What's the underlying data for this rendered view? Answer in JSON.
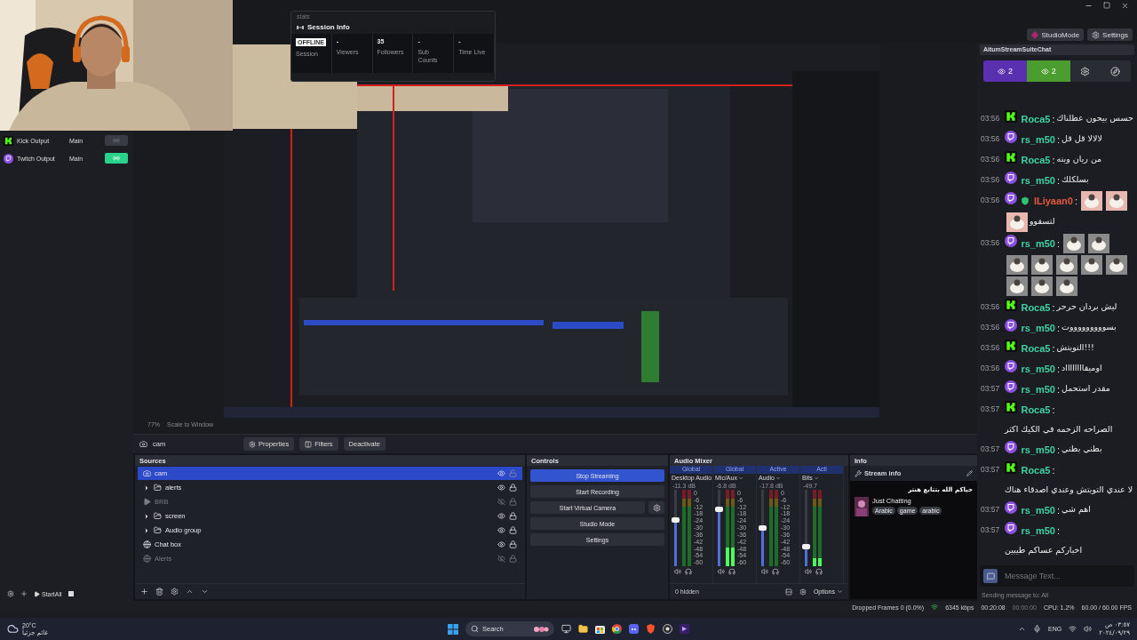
{
  "top_bar": {
    "buttons": [
      {
        "label": "StudioMode",
        "kind": "studio"
      },
      {
        "label": "Settings",
        "kind": "settings"
      }
    ]
  },
  "session_info": {
    "header": "stats",
    "title": "Session Info",
    "stats": [
      {
        "value": "OFFLINE",
        "label": "Session",
        "kind": "badge"
      },
      {
        "value": "-",
        "label": "Viewers",
        "kind": "plain"
      },
      {
        "value": "35",
        "label": "Followers",
        "kind": "plain"
      },
      {
        "value": "-",
        "label": "Sub Counts",
        "kind": "plain"
      },
      {
        "value": "-",
        "label": "Time Live",
        "kind": "plain"
      }
    ]
  },
  "outputs": {
    "items": [
      {
        "kind": "kick",
        "name": "Kick Output",
        "scene": "Main",
        "on": false
      },
      {
        "kind": "twitch",
        "name": "Twitch Output",
        "scene": "Main",
        "on": true
      }
    ],
    "start_label": "StartAll"
  },
  "preview": {
    "zoom": "77%",
    "scale_mode": "Scale to Window"
  },
  "toolbar": {
    "source": "cam",
    "buttons": [
      {
        "label": "Properties",
        "kind": "properties"
      },
      {
        "label": "Filters",
        "kind": "filters"
      },
      {
        "label": "Deactivate",
        "kind": "plain"
      }
    ]
  },
  "sources": {
    "title": "Sources",
    "items": [
      {
        "name": "cam",
        "kind": "camera",
        "selected": true,
        "visible": true,
        "locked": false
      },
      {
        "name": "alerts",
        "kind": "group",
        "selected": false,
        "visible": true,
        "locked": true
      },
      {
        "name": "BRB",
        "kind": "media",
        "selected": false,
        "visible": false,
        "locked": true
      },
      {
        "name": "screen",
        "kind": "group",
        "selected": false,
        "visible": true,
        "locked": true
      },
      {
        "name": "Audio group",
        "kind": "group",
        "selected": false,
        "visible": true,
        "locked": true
      },
      {
        "name": "Chat box",
        "kind": "browser",
        "selected": false,
        "visible": true,
        "locked": true
      },
      {
        "name": "Alerts",
        "kind": "browser",
        "selected": false,
        "visible": false,
        "locked": true
      }
    ]
  },
  "controls": {
    "title": "Controls",
    "buttons": [
      {
        "label": "Stop Streaming",
        "active": true,
        "kind": "plain"
      },
      {
        "label": "Start Recording",
        "active": false,
        "kind": "plain"
      },
      {
        "label": "Start Virtual Camera",
        "active": false,
        "kind": "with_gear"
      },
      {
        "label": "Studio Mode",
        "active": false,
        "kind": "plain"
      },
      {
        "label": "Settings",
        "active": false,
        "kind": "plain"
      }
    ]
  },
  "audio_mixer": {
    "title": "Audio Mixer",
    "channels": [
      {
        "scope": "Global",
        "name": "Desktop Audio",
        "reading": "-11.3 dB",
        "fader": {
          "level": 0.6
        },
        "scale": [
          "0",
          "-6",
          "-12",
          "-18",
          "-24",
          "-30",
          "-36",
          "-42",
          "-48",
          "-54",
          "-60"
        ]
      },
      {
        "scope": "Global",
        "name": "Mic/Aux",
        "reading": "-6.8 dB",
        "fader": {
          "level": 0.74
        },
        "meter": {
          "level": 0.25
        },
        "scale": [
          "0",
          "-6",
          "-12",
          "-18",
          "-24",
          "-30",
          "-36",
          "-42",
          "-48",
          "-54",
          "-60"
        ]
      },
      {
        "scope": "Active",
        "name": "Audio",
        "reading": "-17.8 dB",
        "fader": {
          "level": 0.5
        },
        "scale": [
          "0",
          "-6",
          "-12",
          "-18",
          "-24",
          "-30",
          "-36",
          "-42",
          "-48",
          "-54",
          "-60"
        ]
      },
      {
        "scope": "Acti",
        "name": "Bits",
        "reading": "-49.7",
        "fader": {
          "level": 0.26
        },
        "meter": {
          "level": 0.1
        }
      }
    ],
    "hidden": "0 hidden",
    "options": "Options"
  },
  "info": {
    "title": "Info",
    "panel_title": "Stream info",
    "stream_title": "حياكم الله بتتابع هنتر",
    "category": "Just Chatting",
    "tags": [
      "Arabic",
      "game",
      "arabic"
    ]
  },
  "chat": {
    "title": "AitumStreamSuiteChat",
    "counts": [
      {
        "kind": "twitch",
        "count": "2"
      },
      {
        "kind": "kick",
        "count": "2"
      }
    ],
    "messages": [
      {
        "time": "03:56",
        "kind": "kick",
        "user": "Roca5",
        "color": "#3fd0a0",
        "moderator": false,
        "separator": ":",
        "text": "حسس بيحون عطلناك"
      },
      {
        "time": "03:56",
        "kind": "twitch",
        "user": "rs_m50",
        "color": "#3fd0a0",
        "moderator": false,
        "separator": ":",
        "text": "لالالا قل قل"
      },
      {
        "time": "03:56",
        "kind": "kick",
        "user": "Roca5",
        "color": "#3fd0a0",
        "moderator": false,
        "separator": ":",
        "text": "من ريان وينه"
      },
      {
        "time": "03:56",
        "kind": "twitch",
        "user": "rs_m50",
        "color": "#3fd0a0",
        "moderator": false,
        "separator": ":",
        "text": "بسلكلك"
      },
      {
        "time": "03:56",
        "kind": "twitch",
        "user": "ILiyaan0",
        "color": "#e5583c",
        "moderator": true,
        "separator": ":",
        "text": "لتسقوو",
        "emotes": [
          {
            "color": "#e8b8b0"
          },
          {
            "color": "#e8b8b0"
          },
          {
            "color": "#e8b8b0"
          }
        ]
      },
      {
        "time": "03:56",
        "kind": "twitch",
        "user": "rs_m50",
        "color": "#3fd0a0",
        "moderator": false,
        "separator": ":",
        "emotes": [
          {
            "color": "#8a8a8a"
          },
          {
            "color": "#8a8a8a"
          },
          {
            "color": "#8a8a8a"
          },
          {
            "color": "#8a8a8a"
          },
          {
            "color": "#8a8a8a"
          },
          {
            "color": "#8a8a8a"
          },
          {
            "color": "#8a8a8a"
          },
          {
            "color": "#8a8a8a"
          },
          {
            "color": "#8a8a8a"
          },
          {
            "color": "#8a8a8a"
          }
        ]
      },
      {
        "time": "03:56",
        "kind": "kick",
        "user": "Roca5",
        "color": "#3fd0a0",
        "moderator": false,
        "separator": ":",
        "text": "ليش بردان حرحر"
      },
      {
        "time": "03:56",
        "kind": "twitch",
        "user": "rs_m50",
        "color": "#3fd0a0",
        "moderator": false,
        "separator": ":",
        "text": "بسوووووووووت"
      },
      {
        "time": "03:56",
        "kind": "kick",
        "user": "Roca5",
        "color": "#3fd0a0",
        "moderator": false,
        "separator": ":",
        "text": "التويتش!!!"
      },
      {
        "time": "03:56",
        "kind": "twitch",
        "user": "rs_m50",
        "color": "#3fd0a0",
        "moderator": false,
        "separator": ":",
        "text": "اوميقااااااااد"
      },
      {
        "time": "03:57",
        "kind": "twitch",
        "user": "rs_m50",
        "color": "#3fd0a0",
        "moderator": false,
        "separator": ":",
        "text": "مقدر استحمل"
      },
      {
        "time": "03:57",
        "kind": "kick",
        "user": "Roca5",
        "color": "#3fd0a0",
        "moderator": false,
        "separator": ":",
        "text": "الصراحه الزحمه في الكيك اكثر"
      },
      {
        "time": "03:57",
        "kind": "twitch",
        "user": "rs_m50",
        "color": "#3fd0a0",
        "moderator": false,
        "separator": ":",
        "text": "بطني بطني"
      },
      {
        "time": "03:57",
        "kind": "kick",
        "user": "Roca5",
        "color": "#3fd0a0",
        "moderator": false,
        "separator": ":",
        "text": "لا عندي التويتش وعندي اصدقاء هناك"
      },
      {
        "time": "03:57",
        "kind": "twitch",
        "user": "rs_m50",
        "color": "#3fd0a0",
        "moderator": false,
        "separator": ":",
        "text": "اهم شي"
      },
      {
        "time": "03:57",
        "kind": "twitch",
        "user": "rs_m50",
        "color": "#3fd0a0",
        "moderator": false,
        "separator": ":",
        "text": "اخباركم عساكم طيبين"
      }
    ],
    "input": {
      "placeholder": "Message Text..."
    },
    "footer": "Sending message to: All"
  },
  "status_bar": {
    "dropped": "Dropped Frames 0 (0.0%)",
    "bitrate": "6345 kbps",
    "stream_time": "00:20:08",
    "record_time": "00:00:00",
    "cpu": "CPU: 1.2%",
    "fps": "60.00 / 60.00 FPS"
  },
  "taskbar": {
    "temperature": "20°C",
    "weather": "غائم جزئياً",
    "search": "Search",
    "language": "ENG",
    "time": "٠٣:٥٧ ص",
    "date": "٢٠٢٤/٠٩/٢٩"
  }
}
